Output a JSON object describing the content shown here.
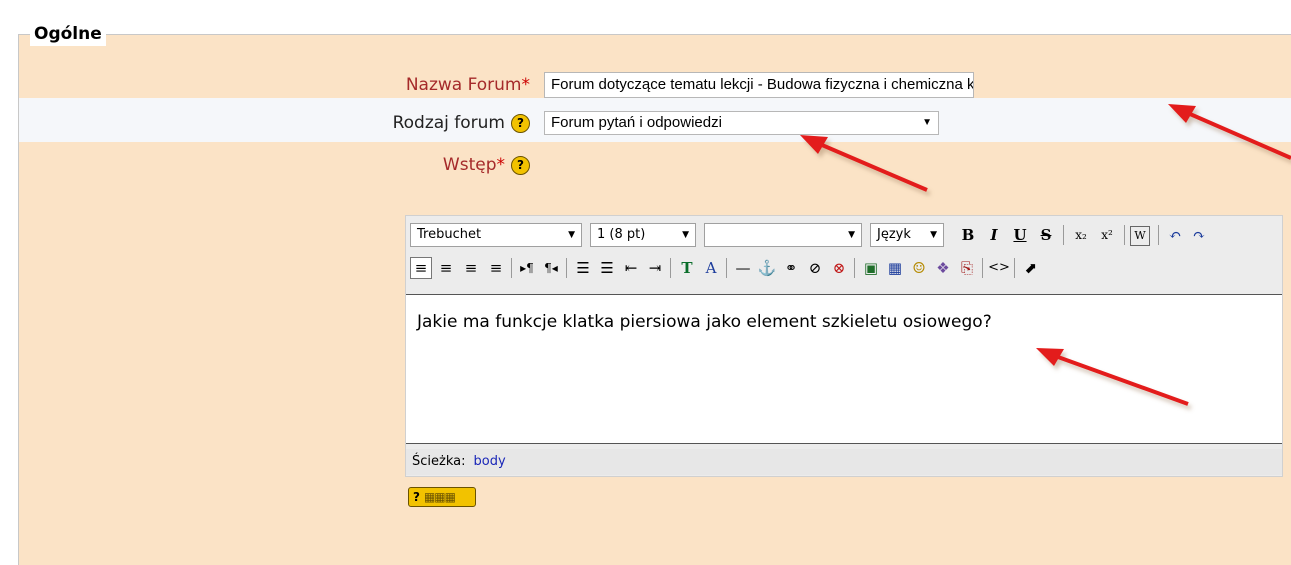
{
  "section": {
    "legend": "Ogólne"
  },
  "fields": {
    "forum_name": {
      "label": "Nazwa Forum",
      "required_mark": "*",
      "value": "Forum dotyczące tematu lekcji - Budowa fizyczna i chemiczna kości"
    },
    "forum_type": {
      "label": "Rodzaj forum",
      "help": "?",
      "value": "Forum pytań i odpowiedzi"
    },
    "intro": {
      "label": "Wstęp",
      "required_mark": "*",
      "help": "?"
    }
  },
  "editor": {
    "font_family": "Trebuchet",
    "font_size": "1 (8 pt)",
    "style_select": "",
    "language": "Język",
    "toolbar1": [
      "B",
      "I",
      "U",
      "S",
      "x₂",
      "x²",
      "W",
      "↶",
      "↷"
    ],
    "toolbar2": [
      "≡",
      "≡",
      "≡",
      "≡",
      "▸¶",
      "¶◂",
      "☰",
      "☰",
      "⇤",
      "⇥",
      "T",
      "A",
      "—",
      "⚓",
      "⚭",
      "⊘",
      "⊗",
      "▣",
      "▦",
      "☺",
      "❖",
      "⎘",
      "<>",
      "⬈"
    ],
    "content": "Jakie ma funkcje klatka piersiowa jako element szkieletu osiowego?",
    "path_label": "Ścieżka:",
    "path_value": "body"
  },
  "help_button": {
    "label": "?"
  },
  "colors": {
    "form_bg": "#fbe3c6",
    "required": "#a52a2a",
    "arrow": "#e31b1b"
  }
}
